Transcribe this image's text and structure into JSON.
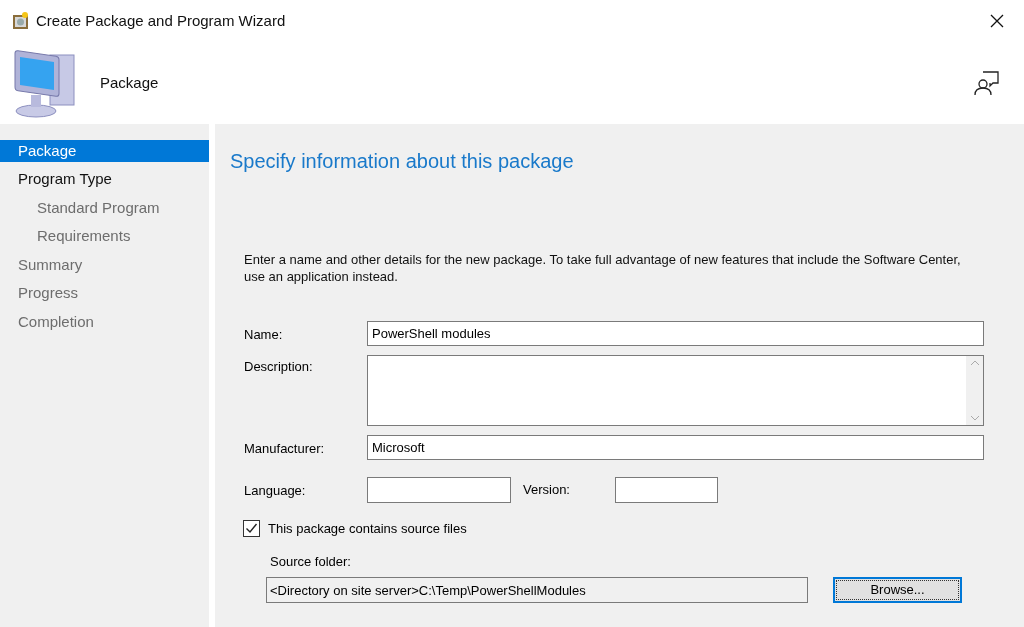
{
  "window": {
    "title": "Create Package and Program Wizard"
  },
  "header": {
    "title": "Package"
  },
  "sidebar": {
    "items": [
      {
        "label": "Package",
        "selected": true,
        "disabled": false
      },
      {
        "label": "Program Type",
        "selected": false,
        "disabled": false,
        "children": [
          {
            "label": "Standard Program",
            "selected": false,
            "disabled": true
          },
          {
            "label": "Requirements",
            "selected": false,
            "disabled": true
          }
        ]
      },
      {
        "label": "Summary",
        "selected": false,
        "disabled": true
      },
      {
        "label": "Progress",
        "selected": false,
        "disabled": true
      },
      {
        "label": "Completion",
        "selected": false,
        "disabled": true
      }
    ]
  },
  "page": {
    "heading": "Specify information about this package",
    "intro": "Enter a name and other details for the new package. To take full advantage of new features that include the Software Center, use an application instead.",
    "name": {
      "label": "Name:",
      "value": "PowerShell modules"
    },
    "description": {
      "label": "Description:"
    },
    "manufacturer": {
      "label": "Manufacturer:",
      "value": "Microsoft"
    },
    "language": {
      "label": "Language:"
    },
    "version": {
      "label": "Version:"
    },
    "source_files": {
      "label": "This package contains source files",
      "checked": true
    },
    "source_folder": {
      "label": "Source folder:",
      "value": "<Directory on site server>C:\\Temp\\PowerShellModules"
    },
    "browse_button": "Browse..."
  }
}
